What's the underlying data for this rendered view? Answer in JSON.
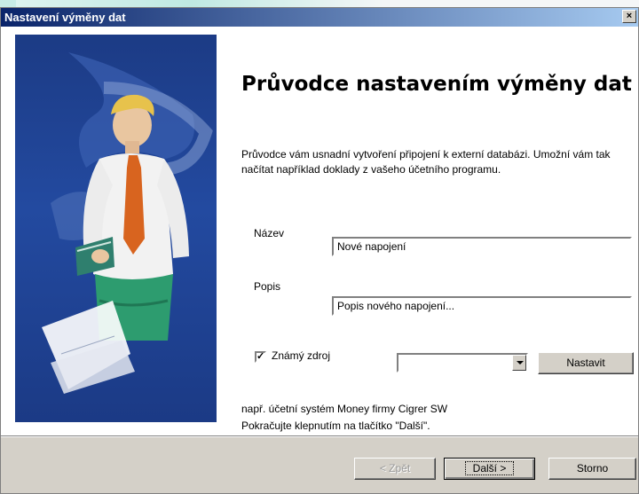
{
  "window": {
    "title": "Nastavení výměny dat",
    "close_glyph": "×"
  },
  "wizard": {
    "heading": "Průvodce nastavením výměny dat",
    "description": "Průvodce vám usnadní vytvoření připojení k externí databázi. Umožní vám tak načítat například doklady z vašeho účetního programu.",
    "name_label": "Název",
    "name_value": "Nové napojení",
    "desc_label": "Popis",
    "desc_value": "Popis nového napojení...",
    "known_source_label": "Známý zdroj",
    "known_source_checked": true,
    "known_source_selected": "",
    "setup_button": "Nastavit",
    "hint_line1": "např. účetní systém Money firmy Cigrer SW",
    "hint_line2": "Pokračujte klepnutím na tlačítko \"Další\"."
  },
  "buttons": {
    "back": "< Zpět",
    "next": "Další >",
    "cancel": "Storno"
  },
  "icons": {
    "close": "close-icon",
    "dropdown": "chevron-down-icon",
    "checkbox": "checkmark-icon"
  },
  "colors": {
    "titlebar_start": "#0a246a",
    "titlebar_end": "#a6caf0",
    "art_background": "#1c3b85",
    "dialog_face": "#d4d0c8"
  }
}
